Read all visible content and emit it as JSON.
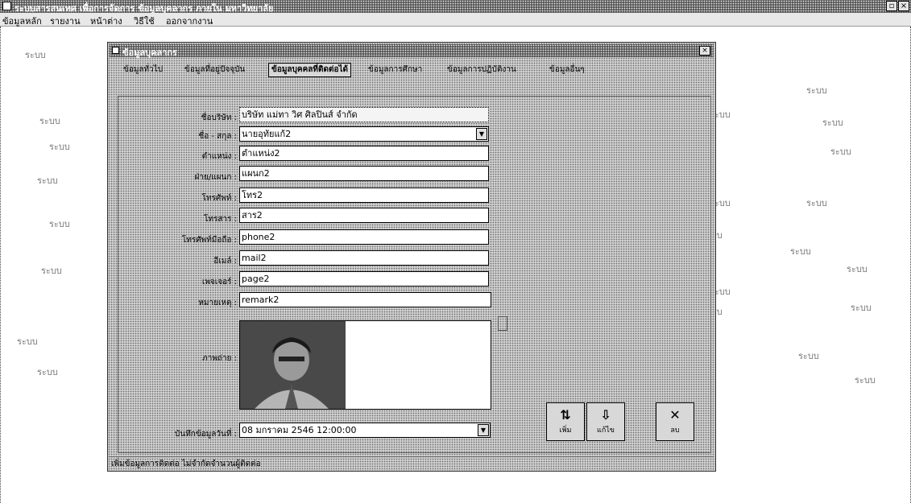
{
  "window": {
    "title": "ระบบสารสนเทศ เพื่อการจัดการ ข้อมูลบุคลากร ภายใน มหาวิทยาลัย",
    "menu": [
      "ข้อมูลหลัก",
      "รายงาน",
      "หน้าต่าง",
      "วิธีใช้",
      "ออกจากงาน"
    ],
    "controls": {
      "restore": "▫",
      "close": "×"
    }
  },
  "dialog": {
    "title": "ข้อมูลบุคลากร",
    "close": "×",
    "tabs": [
      {
        "label": "ข้อมูลทั่วไป",
        "active": false
      },
      {
        "label": "ข้อมูลที่อยู่ปัจจุบัน",
        "active": false
      },
      {
        "label": "ข้อมูลบุคคลที่ติดต่อได้",
        "active": true
      },
      {
        "label": "ข้อมูลการศึกษา",
        "active": false
      },
      {
        "label": "ข้อมูลการปฏิบัติงาน",
        "active": false
      },
      {
        "label": "ข้อมูลอื่นๆ",
        "active": false
      }
    ],
    "fields": [
      {
        "label": "ชื่อบริษัท :",
        "value": "บริษัท แม่ทา วิศ ศิลปินส์ จำกัด",
        "kind": "highlight"
      },
      {
        "label": "ชื่อ - สกุล :",
        "value": "นายอุทัยแก้2",
        "kind": "combo"
      },
      {
        "label": "ตำแหน่ง :",
        "value": "ตำแหน่ง2",
        "kind": "text"
      },
      {
        "label": "ฝ่าย/แผนก :",
        "value": "แผนก2",
        "kind": "text"
      },
      {
        "label": "โทรศัพท์ :",
        "value": "โทร2",
        "kind": "text"
      },
      {
        "label": "โทรสาร :",
        "value": "สาร2",
        "kind": "text"
      },
      {
        "label": "โทรศัพท์มือถือ :",
        "value": "phone2",
        "kind": "text"
      },
      {
        "label": "อีเมล์ :",
        "value": "mail2",
        "kind": "text"
      },
      {
        "label": "เพจเจอร์ :",
        "value": "page2",
        "kind": "text"
      },
      {
        "label": "หมายเหตุ :",
        "value": "remark2",
        "kind": "text"
      }
    ],
    "photo_label": "ภาพถ่าย :",
    "photo_icon": "person-photo",
    "record_date": {
      "label": "บันทึกข้อมูลวันที่ :",
      "value": "08 มกราคม 2546 12:00:00"
    },
    "buttons": [
      {
        "id": "add",
        "icon": "⇅",
        "label": "เพิ่ม"
      },
      {
        "id": "save",
        "icon": "⇩",
        "label": "แก้ไข"
      },
      {
        "id": "delete",
        "icon": "✕",
        "label": "ลบ"
      }
    ],
    "status": "เพิ่มข้อมูลการติดต่อ ไม่จำกัดจำนวนผู้ติดต่อ"
  },
  "watermark": {
    "marks": [
      "ระบบ",
      "ระบบ",
      "ระบบ",
      "ระบบ",
      "ระบบ",
      "ระบบ",
      "ระบบ",
      "ระบบ",
      "ระบบ",
      "ระบบ",
      "ระบบ",
      "ระบบ",
      "ระบบ",
      "ระบบ",
      "ระบบ",
      "ระบบ",
      "ระบบ",
      "ระบบ",
      "ระบบ",
      "ระบบ",
      "ระบบ",
      "ระบบ",
      "ระบบ",
      "ระบบ",
      "ระบบ",
      "ระบบ"
    ]
  }
}
